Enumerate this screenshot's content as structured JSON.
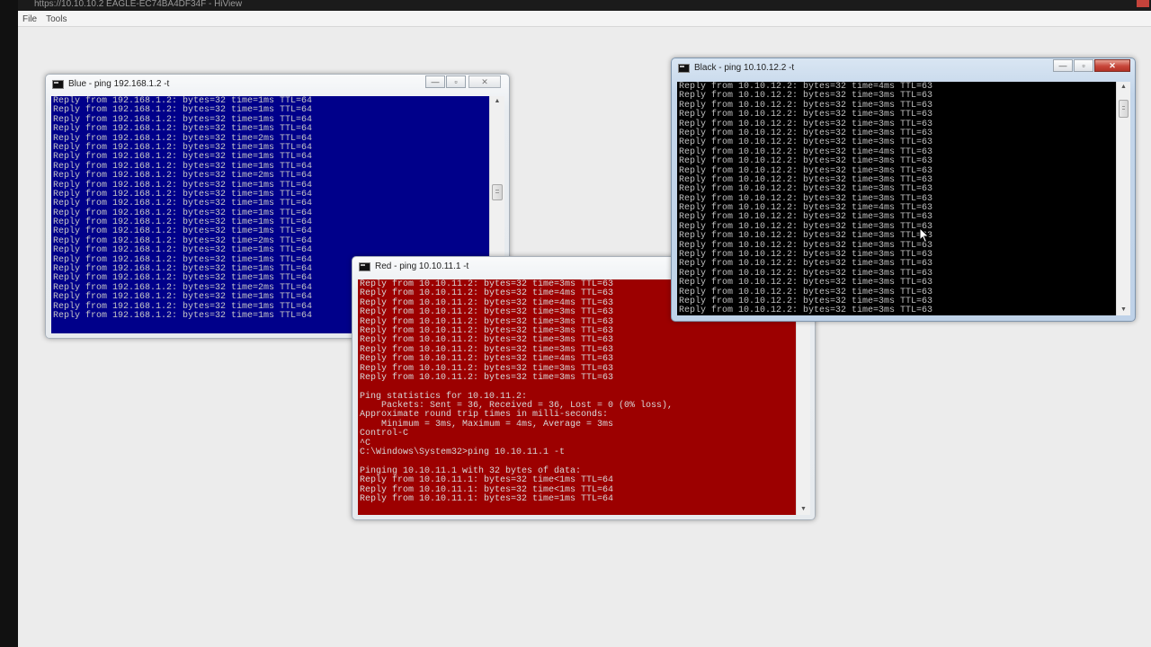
{
  "viewer": {
    "title": "https://10.10.10.2 EAGLE-EC74BA4DF34F - HiView",
    "menu": [
      "File",
      "Tools"
    ]
  },
  "windows": {
    "blue": {
      "title": "Blue - ping  192.168.1.2 -t",
      "bg_color": "#00008a",
      "fg_color": "#c8c8c8",
      "lines": [
        "Reply from 192.168.1.2: bytes=32 time=1ms TTL=64",
        "Reply from 192.168.1.2: bytes=32 time=1ms TTL=64",
        "Reply from 192.168.1.2: bytes=32 time=1ms TTL=64",
        "Reply from 192.168.1.2: bytes=32 time=1ms TTL=64",
        "Reply from 192.168.1.2: bytes=32 time=2ms TTL=64",
        "Reply from 192.168.1.2: bytes=32 time=1ms TTL=64",
        "Reply from 192.168.1.2: bytes=32 time=1ms TTL=64",
        "Reply from 192.168.1.2: bytes=32 time=1ms TTL=64",
        "Reply from 192.168.1.2: bytes=32 time=2ms TTL=64",
        "Reply from 192.168.1.2: bytes=32 time=1ms TTL=64",
        "Reply from 192.168.1.2: bytes=32 time=1ms TTL=64",
        "Reply from 192.168.1.2: bytes=32 time=1ms TTL=64",
        "Reply from 192.168.1.2: bytes=32 time=1ms TTL=64",
        "Reply from 192.168.1.2: bytes=32 time=1ms TTL=64",
        "Reply from 192.168.1.2: bytes=32 time=1ms TTL=64",
        "Reply from 192.168.1.2: bytes=32 time=2ms TTL=64",
        "Reply from 192.168.1.2: bytes=32 time=1ms TTL=64",
        "Reply from 192.168.1.2: bytes=32 time=1ms TTL=64",
        "Reply from 192.168.1.2: bytes=32 time=1ms TTL=64",
        "Reply from 192.168.1.2: bytes=32 time=1ms TTL=64",
        "Reply from 192.168.1.2: bytes=32 time=2ms TTL=64",
        "Reply from 192.168.1.2: bytes=32 time=1ms TTL=64",
        "Reply from 192.168.1.2: bytes=32 time=1ms TTL=64",
        "Reply from 192.168.1.2: bytes=32 time=1ms TTL=64"
      ]
    },
    "red": {
      "title": "Red - ping  10.10.11.1 -t",
      "bg_color": "#9c0000",
      "fg_color": "#d8d8d8",
      "lines": [
        "Reply from 10.10.11.2: bytes=32 time=3ms TTL=63",
        "Reply from 10.10.11.2: bytes=32 time=4ms TTL=63",
        "Reply from 10.10.11.2: bytes=32 time=4ms TTL=63",
        "Reply from 10.10.11.2: bytes=32 time=3ms TTL=63",
        "Reply from 10.10.11.2: bytes=32 time=3ms TTL=63",
        "Reply from 10.10.11.2: bytes=32 time=3ms TTL=63",
        "Reply from 10.10.11.2: bytes=32 time=3ms TTL=63",
        "Reply from 10.10.11.2: bytes=32 time=3ms TTL=63",
        "Reply from 10.10.11.2: bytes=32 time=4ms TTL=63",
        "Reply from 10.10.11.2: bytes=32 time=3ms TTL=63",
        "Reply from 10.10.11.2: bytes=32 time=3ms TTL=63",
        "",
        "Ping statistics for 10.10.11.2:",
        "    Packets: Sent = 36, Received = 36, Lost = 0 (0% loss),",
        "Approximate round trip times in milli-seconds:",
        "    Minimum = 3ms, Maximum = 4ms, Average = 3ms",
        "Control-C",
        "^C",
        "C:\\Windows\\System32>ping 10.10.11.1 -t",
        "",
        "Pinging 10.10.11.1 with 32 bytes of data:",
        "Reply from 10.10.11.1: bytes=32 time<1ms TTL=64",
        "Reply from 10.10.11.1: bytes=32 time<1ms TTL=64",
        "Reply from 10.10.11.1: bytes=32 time=1ms TTL=64"
      ]
    },
    "black": {
      "title": "Black - ping  10.10.12.2 -t",
      "bg_color": "#000000",
      "fg_color": "#c0c0c0",
      "lines": [
        "Reply from 10.10.12.2: bytes=32 time=4ms TTL=63",
        "Reply from 10.10.12.2: bytes=32 time=3ms TTL=63",
        "Reply from 10.10.12.2: bytes=32 time=3ms TTL=63",
        "Reply from 10.10.12.2: bytes=32 time=3ms TTL=63",
        "Reply from 10.10.12.2: bytes=32 time=3ms TTL=63",
        "Reply from 10.10.12.2: bytes=32 time=3ms TTL=63",
        "Reply from 10.10.12.2: bytes=32 time=3ms TTL=63",
        "Reply from 10.10.12.2: bytes=32 time=4ms TTL=63",
        "Reply from 10.10.12.2: bytes=32 time=3ms TTL=63",
        "Reply from 10.10.12.2: bytes=32 time=3ms TTL=63",
        "Reply from 10.10.12.2: bytes=32 time=3ms TTL=63",
        "Reply from 10.10.12.2: bytes=32 time=3ms TTL=63",
        "Reply from 10.10.12.2: bytes=32 time=3ms TTL=63",
        "Reply from 10.10.12.2: bytes=32 time=4ms TTL=63",
        "Reply from 10.10.12.2: bytes=32 time=3ms TTL=63",
        "Reply from 10.10.12.2: bytes=32 time=3ms TTL=63",
        "Reply from 10.10.12.2: bytes=32 time=3ms TTL=63",
        "Reply from 10.10.12.2: bytes=32 time=3ms TTL=63",
        "Reply from 10.10.12.2: bytes=32 time=3ms TTL=63",
        "Reply from 10.10.12.2: bytes=32 time=3ms TTL=63",
        "Reply from 10.10.12.2: bytes=32 time=3ms TTL=63",
        "Reply from 10.10.12.2: bytes=32 time=3ms TTL=63",
        "Reply from 10.10.12.2: bytes=32 time=3ms TTL=63",
        "Reply from 10.10.12.2: bytes=32 time=3ms TTL=63",
        "Reply from 10.10.12.2: bytes=32 time=3ms TTL=63"
      ]
    }
  },
  "controls": {
    "minimize": "—",
    "maximize": "▫",
    "close": "✕"
  }
}
